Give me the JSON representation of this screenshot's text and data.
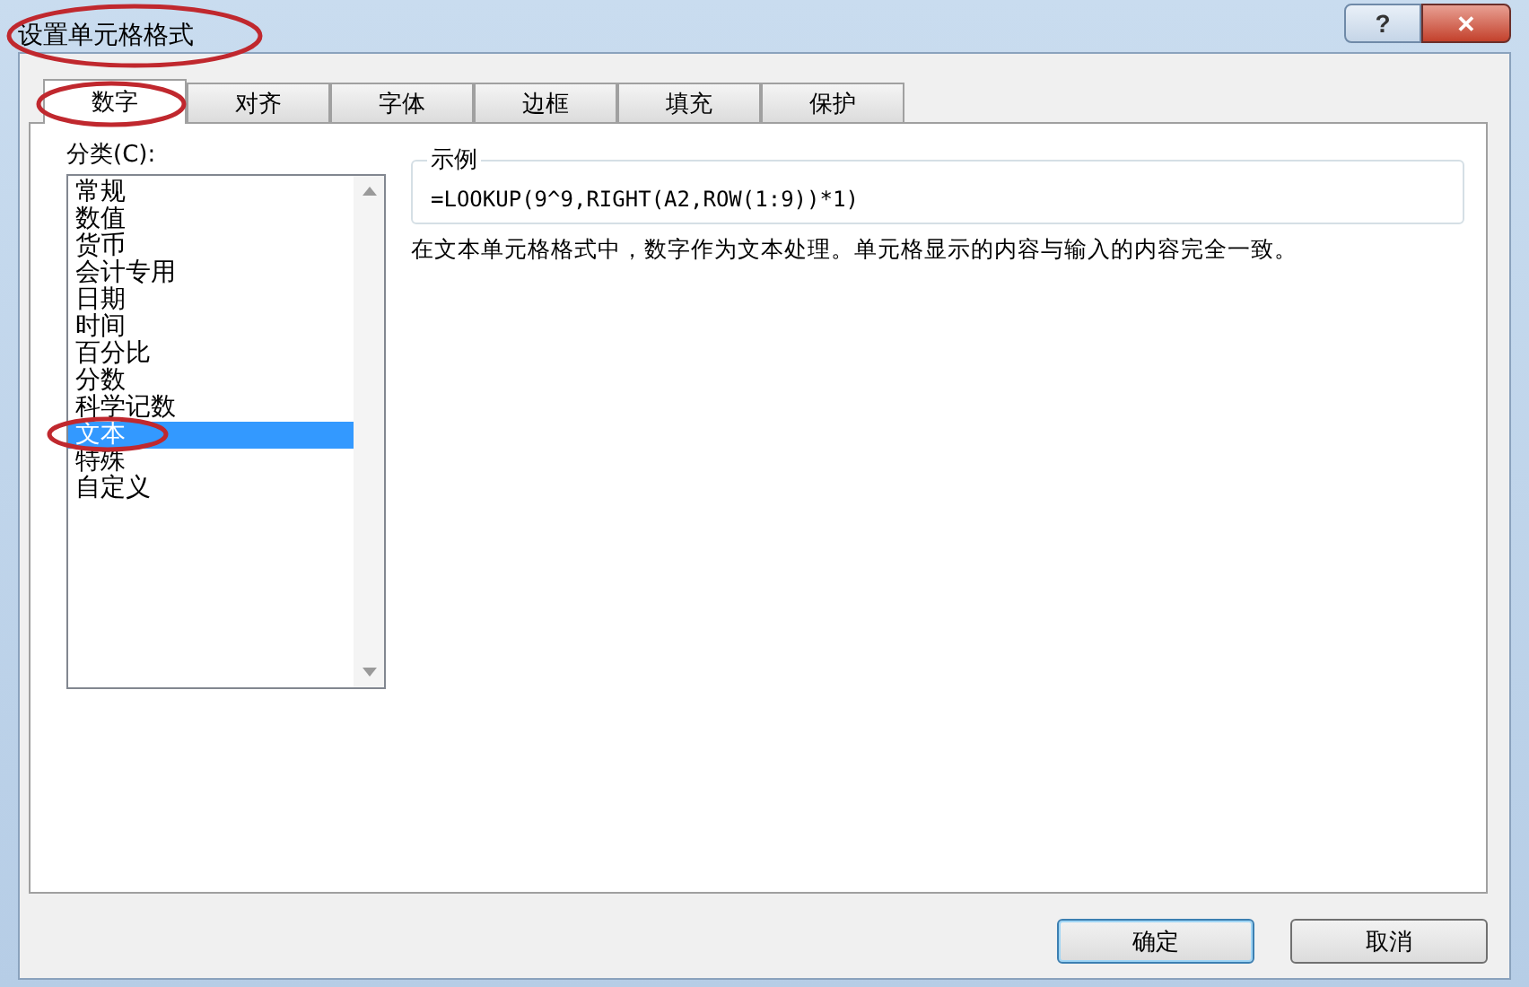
{
  "window": {
    "title": "设置单元格格式",
    "help_button": "?",
    "close_button": "✕"
  },
  "tabs": [
    {
      "label": "数字",
      "selected": true
    },
    {
      "label": "对齐",
      "selected": false
    },
    {
      "label": "字体",
      "selected": false
    },
    {
      "label": "边框",
      "selected": false
    },
    {
      "label": "填充",
      "selected": false
    },
    {
      "label": "保护",
      "selected": false
    }
  ],
  "category": {
    "label": "分类(C):",
    "items": [
      {
        "label": "常规",
        "selected": false
      },
      {
        "label": "数值",
        "selected": false
      },
      {
        "label": "货币",
        "selected": false
      },
      {
        "label": "会计专用",
        "selected": false
      },
      {
        "label": "日期",
        "selected": false
      },
      {
        "label": "时间",
        "selected": false
      },
      {
        "label": "百分比",
        "selected": false
      },
      {
        "label": "分数",
        "selected": false
      },
      {
        "label": "科学记数",
        "selected": false
      },
      {
        "label": "文本",
        "selected": true
      },
      {
        "label": "特殊",
        "selected": false
      },
      {
        "label": "自定义",
        "selected": false
      }
    ]
  },
  "sample": {
    "label": "示例",
    "value": "=LOOKUP(9^9,RIGHT(A2,ROW(1:9))*1)"
  },
  "description": "在文本单元格格式中，数字作为文本处理。单元格显示的内容与输入的内容完全一致。",
  "buttons": [
    {
      "label": "确定",
      "default": true
    },
    {
      "label": "取消",
      "default": false
    }
  ]
}
